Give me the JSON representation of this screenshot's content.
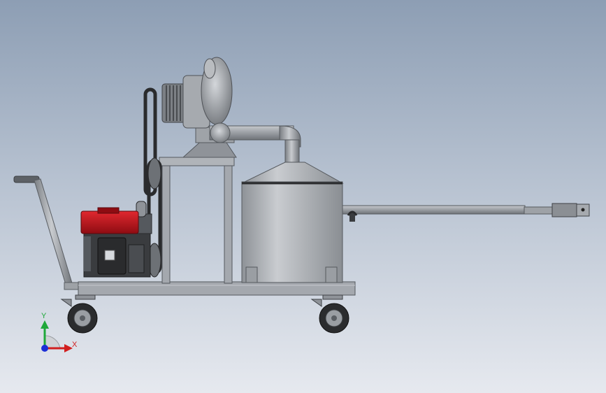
{
  "triad": {
    "y_label": "Y",
    "x_label": "X"
  },
  "colors": {
    "background_top": "#8d9eb4",
    "background_bottom": "#e6e9ef",
    "steel": "#a9adb3",
    "steel_dark": "#6e7277",
    "frame": "#9a9ea4",
    "engine_red": "#c4121c",
    "engine_dark": "#3a3c3f",
    "tire": "#2b2c2e",
    "axis_x": "#d11f1f",
    "axis_y": "#1fa83a",
    "axis_z": "#1c2fd6"
  }
}
